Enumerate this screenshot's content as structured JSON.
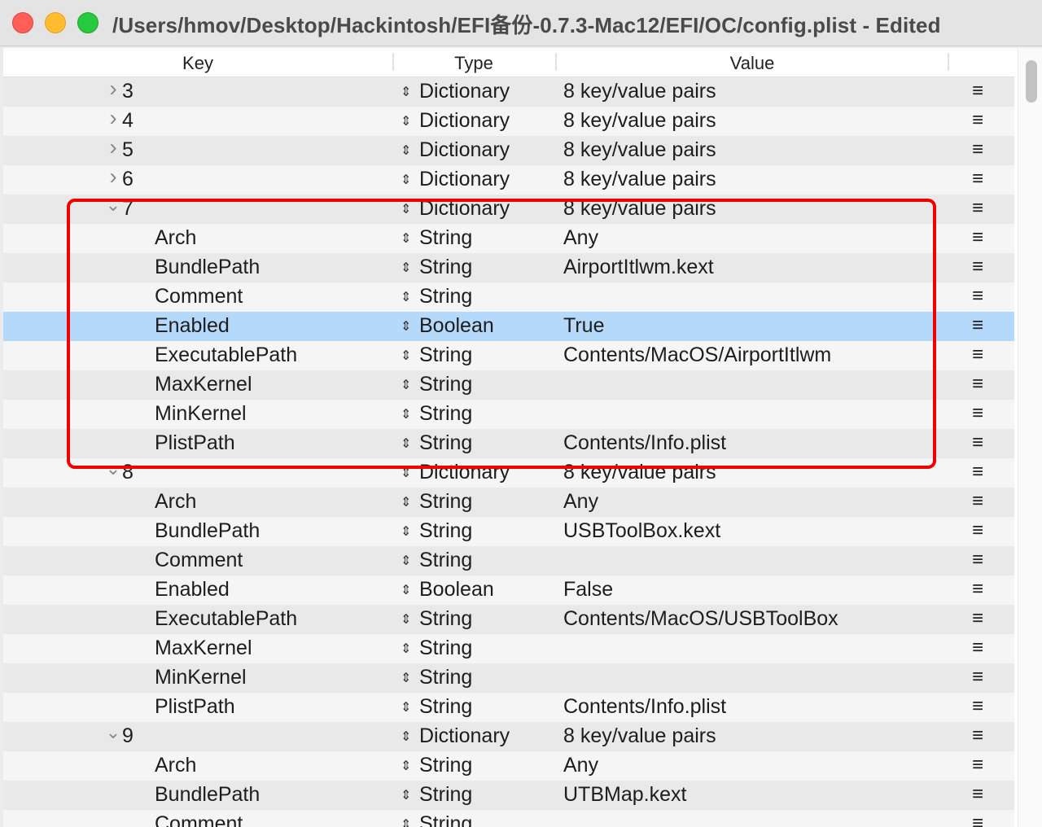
{
  "window": {
    "title": "/Users/hmov/Desktop/Hackintosh/EFI备份-0.7.3-Mac12/EFI/OC/config.plist - Edited"
  },
  "columns": {
    "key": "Key",
    "type": "Type",
    "value": "Value"
  },
  "icons": {
    "disclosure_collapsed": "chevron-right-icon",
    "disclosure_expanded": "chevron-down-icon",
    "type_stepper": "up-down-arrows-icon",
    "row_menu": "hamburger-menu-icon"
  },
  "colors": {
    "highlight_box": "#f20000",
    "selected_row": "#b5d9fb"
  },
  "highlight": {
    "description_target_rows": "7 through PlistPath"
  },
  "rows": [
    {
      "key": "3",
      "type": "Dictionary",
      "value": "8 key/value pairs",
      "level": 0,
      "disclosure": "collapsed",
      "menu": "≡"
    },
    {
      "key": "4",
      "type": "Dictionary",
      "value": "8 key/value pairs",
      "level": 0,
      "disclosure": "collapsed",
      "menu": "≡"
    },
    {
      "key": "5",
      "type": "Dictionary",
      "value": "8 key/value pairs",
      "level": 0,
      "disclosure": "collapsed",
      "menu": "≡"
    },
    {
      "key": "6",
      "type": "Dictionary",
      "value": "8 key/value pairs",
      "level": 0,
      "disclosure": "collapsed",
      "menu": "≡"
    },
    {
      "key": "7",
      "type": "Dictionary",
      "value": "8 key/value pairs",
      "level": 0,
      "disclosure": "expanded",
      "menu": "≡"
    },
    {
      "key": "Arch",
      "type": "String",
      "value": "Any",
      "level": 1,
      "menu": "≡"
    },
    {
      "key": "BundlePath",
      "type": "String",
      "value": "AirportItlwm.kext",
      "level": 1,
      "menu": "≡"
    },
    {
      "key": "Comment",
      "type": "String",
      "value": "",
      "level": 1,
      "menu": "≡"
    },
    {
      "key": "Enabled",
      "type": "Boolean",
      "value": "True",
      "level": 1,
      "selected": true,
      "menu": "≡"
    },
    {
      "key": "ExecutablePath",
      "type": "String",
      "value": "Contents/MacOS/AirportItlwm",
      "level": 1,
      "menu": "≡"
    },
    {
      "key": "MaxKernel",
      "type": "String",
      "value": "",
      "level": 1,
      "menu": "≡"
    },
    {
      "key": "MinKernel",
      "type": "String",
      "value": "",
      "level": 1,
      "menu": "≡"
    },
    {
      "key": "PlistPath",
      "type": "String",
      "value": "Contents/Info.plist",
      "level": 1,
      "menu": "≡"
    },
    {
      "key": "8",
      "type": "Dictionary",
      "value": "8 key/value pairs",
      "level": 0,
      "disclosure": "expanded",
      "menu": "≡"
    },
    {
      "key": "Arch",
      "type": "String",
      "value": "Any",
      "level": 1,
      "menu": "≡"
    },
    {
      "key": "BundlePath",
      "type": "String",
      "value": "USBToolBox.kext",
      "level": 1,
      "menu": "≡"
    },
    {
      "key": "Comment",
      "type": "String",
      "value": "",
      "level": 1,
      "menu": "≡"
    },
    {
      "key": "Enabled",
      "type": "Boolean",
      "value": "False",
      "level": 1,
      "menu": "≡"
    },
    {
      "key": "ExecutablePath",
      "type": "String",
      "value": "Contents/MacOS/USBToolBox",
      "level": 1,
      "menu": "≡"
    },
    {
      "key": "MaxKernel",
      "type": "String",
      "value": "",
      "level": 1,
      "menu": "≡"
    },
    {
      "key": "MinKernel",
      "type": "String",
      "value": "",
      "level": 1,
      "menu": "≡"
    },
    {
      "key": "PlistPath",
      "type": "String",
      "value": "Contents/Info.plist",
      "level": 1,
      "menu": "≡"
    },
    {
      "key": "9",
      "type": "Dictionary",
      "value": "8 key/value pairs",
      "level": 0,
      "disclosure": "expanded",
      "menu": "≡"
    },
    {
      "key": "Arch",
      "type": "String",
      "value": "Any",
      "level": 1,
      "menu": "≡"
    },
    {
      "key": "BundlePath",
      "type": "String",
      "value": "UTBMap.kext",
      "level": 1,
      "menu": "≡"
    },
    {
      "key": "Comment",
      "type": "String",
      "value": "",
      "level": 1,
      "menu": "≡"
    }
  ]
}
